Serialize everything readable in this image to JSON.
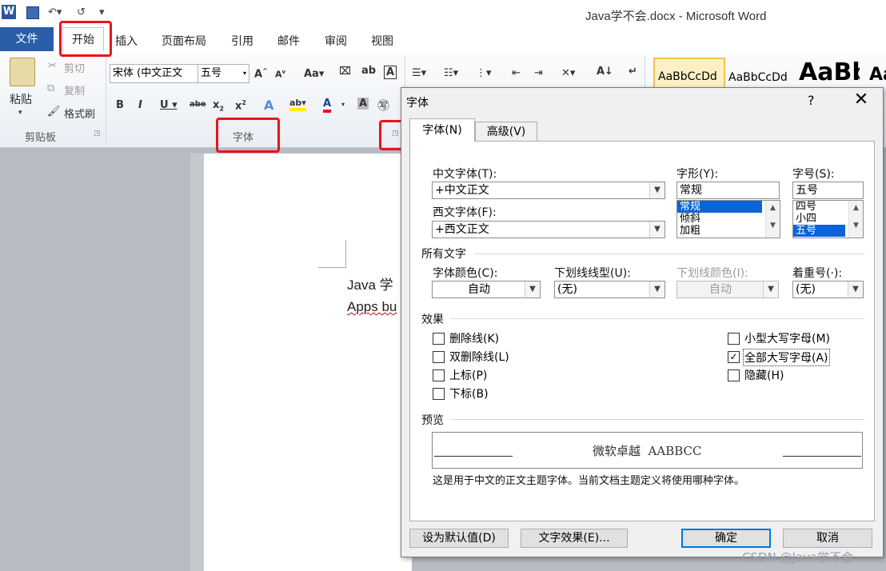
{
  "window": {
    "title": "Java学不会.docx - Microsoft Word"
  },
  "ribbon": {
    "file_tab": "文件",
    "tabs": [
      "开始",
      "插入",
      "页面布局",
      "引用",
      "邮件",
      "审阅",
      "视图"
    ],
    "clipboard": {
      "paste": "粘贴",
      "cut": "剪切",
      "copy": "复制",
      "format_painter": "格式刷",
      "group_label": "剪贴板"
    },
    "font": {
      "font_name": "宋体 (中文正文",
      "font_size": "五号",
      "group_label": "字体"
    },
    "styles": [
      "AaBbCcDd",
      "AaBbCcDd",
      "AaBb",
      "Aa"
    ]
  },
  "document": {
    "lines": [
      "Java 学",
      "Apps bu"
    ]
  },
  "dialog": {
    "title": "字体",
    "help": "?",
    "close": "✕",
    "tabs": [
      "字体(N)",
      "高级(V)"
    ],
    "cn_font_label": "中文字体(T):",
    "cn_font_value": "+中文正文",
    "west_font_label": "西文字体(F):",
    "west_font_value": "+西文正文",
    "style_label": "字形(Y):",
    "style_value": "常规",
    "style_options": [
      "常规",
      "倾斜",
      "加粗"
    ],
    "size_label": "字号(S):",
    "size_value": "五号",
    "size_options": [
      "四号",
      "小四",
      "五号"
    ],
    "all_text_label": "所有文字",
    "font_color_label": "字体颜色(C):",
    "font_color_value": "自动",
    "underline_style_label": "下划线线型(U):",
    "underline_style_value": "(无)",
    "underline_color_label": "下划线颜色(I):",
    "underline_color_value": "自动",
    "emphasis_label": "着重号(·):",
    "emphasis_value": "(无)",
    "effects_label": "效果",
    "effects_left": [
      {
        "label": "删除线(K)",
        "checked": false
      },
      {
        "label": "双删除线(L)",
        "checked": false
      },
      {
        "label": "上标(P)",
        "checked": false
      },
      {
        "label": "下标(B)",
        "checked": false
      }
    ],
    "effects_right": [
      {
        "label": "小型大写字母(M)",
        "checked": false
      },
      {
        "label": "全部大写字母(A)",
        "checked": true
      },
      {
        "label": "隐藏(H)",
        "checked": false
      }
    ],
    "preview_label": "预览",
    "preview_text": "微软卓越  AABBCC",
    "preview_note": "这是用于中文的正文主题字体。当前文档主题定义将使用哪种字体。",
    "buttons": {
      "set_default": "设为默认值(D)",
      "text_effects": "文字效果(E)...",
      "ok": "确定",
      "cancel": "取消"
    }
  },
  "watermark": "CSDN @Java学不会",
  "colors": {
    "file_tab": "#2a5fa8",
    "highlight": "#e8141b",
    "selection": "#0a64d8"
  }
}
